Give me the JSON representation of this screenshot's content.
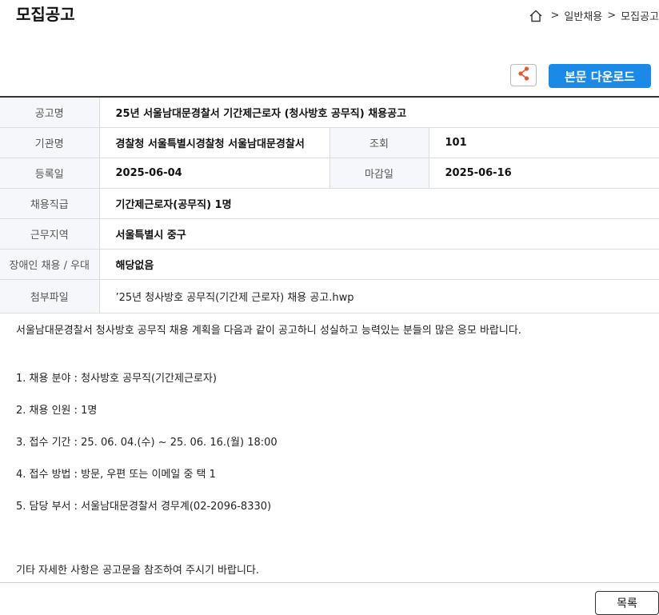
{
  "header": {
    "title": "모집공고",
    "breadcrumb": [
      "일반채용",
      "모집공고"
    ],
    "breadcrumb_sep": ">"
  },
  "toolbar": {
    "download_label": "본문 다운로드"
  },
  "info": {
    "title_label": "공고명",
    "title_value": "25년 서울남대문경찰서 기간제근로자 (청사방호 공무직) 채용공고",
    "org_label": "기관명",
    "org_value": "경찰청 서울특별시경찰청 서울남대문경찰서",
    "views_label": "조회",
    "views_value": "101",
    "reg_label": "등록일",
    "reg_value": "2025-06-04",
    "deadline_label": "마감일",
    "deadline_value": "2025-06-16",
    "grade_label": "채용직급",
    "grade_value": "기간제근로자(공무직) 1명",
    "region_label": "근무지역",
    "region_value": "서울특별시 중구",
    "disability_label": "장애인 채용 / 우대",
    "disability_value": "해당없음",
    "attach_label": "첨부파일",
    "attach_value": "’25년 청사방호 공무직(기간제 근로자) 채용 공고.hwp"
  },
  "body": {
    "intro": "서울남대문경찰서 청사방호 공무직 채용 계획을 다음과 같이 공고하니 성실하고 능력있는 분들의 많은 응모 바랍니다.",
    "items": [
      "1. 채용 분야 : 청사방호 공무직(기간제근로자)",
      "2. 채용 인원 : 1명",
      "3. 접수 기간 : 25. 06. 04.(수) ~ 25.  06.  16.(월) 18:00",
      "4. 접수 방법 : 방문, 우편 또는 이메일 중 택 1",
      "5. 담당 부서 : 서울남대문경찰서 경무계(02-2096-8330)"
    ],
    "closing": "기타 자세한 사항은 공고문을 참조하여 주시기 바랍니다."
  },
  "footer": {
    "list_label": "목록"
  },
  "colors": {
    "accent": "#1a8ae6",
    "share_icon": "#e8572c"
  },
  "icons": {
    "home": "home-icon",
    "share": "share-icon"
  }
}
